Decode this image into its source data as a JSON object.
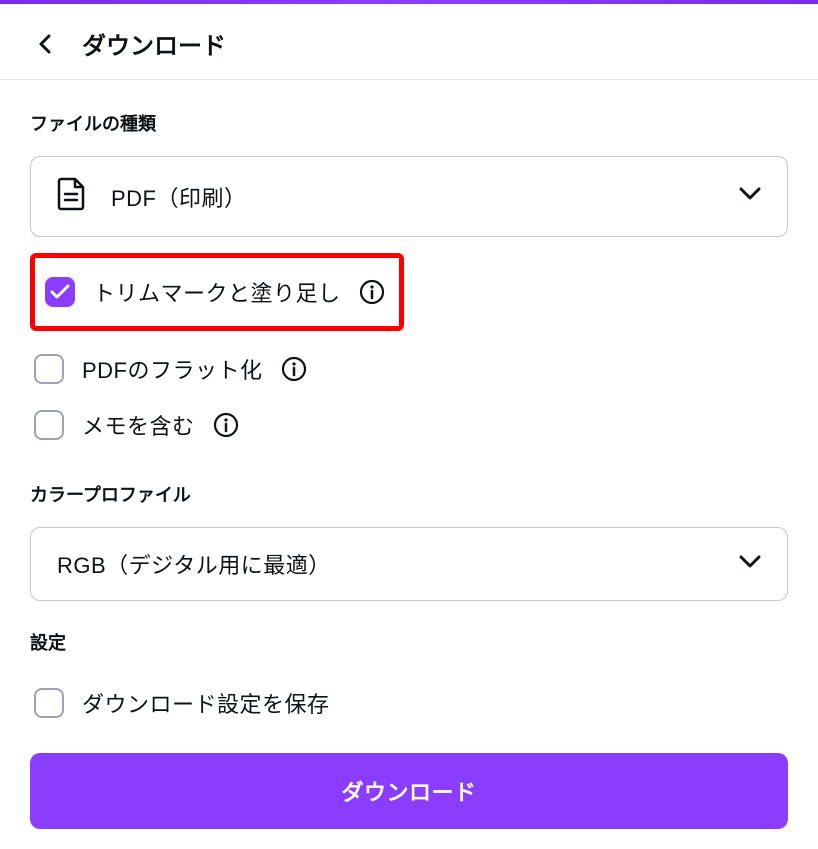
{
  "header": {
    "title": "ダウンロード"
  },
  "fileType": {
    "label": "ファイルの種類",
    "selected": "PDF（印刷）"
  },
  "options": {
    "trimMarks": "トリムマークと塗り足し",
    "flatten": "PDFのフラット化",
    "includeNotes": "メモを含む"
  },
  "colorProfile": {
    "label": "カラープロファイル",
    "selected": "RGB（デジタル用に最適）"
  },
  "settings": {
    "label": "設定",
    "saveSettings": "ダウンロード設定を保存"
  },
  "downloadButton": "ダウンロード"
}
